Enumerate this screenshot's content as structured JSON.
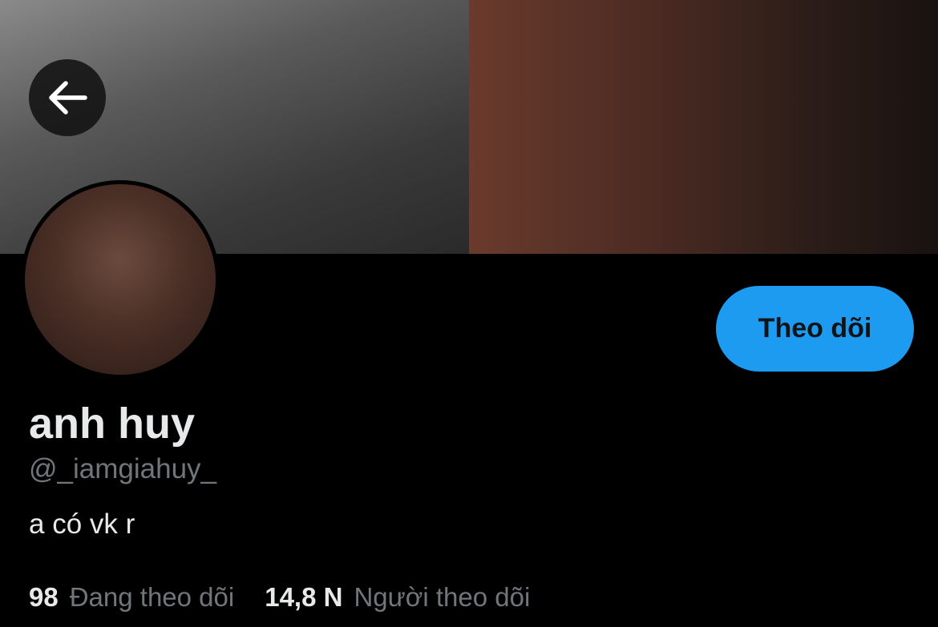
{
  "profile": {
    "display_name": "anh huy",
    "handle": "@_iamgiahuy_",
    "bio": "a có vk r",
    "follow_label": "Theo dõi"
  },
  "stats": {
    "following_count": "98",
    "following_label": "Đang theo dõi",
    "followers_count": "14,8 N",
    "followers_label": "Người theo dõi"
  },
  "icons": {
    "back": "arrow-left-icon"
  },
  "colors": {
    "background": "#000000",
    "accent": "#1d9bf0",
    "primary_text": "#e7e9ea",
    "secondary_text": "#71767b"
  }
}
